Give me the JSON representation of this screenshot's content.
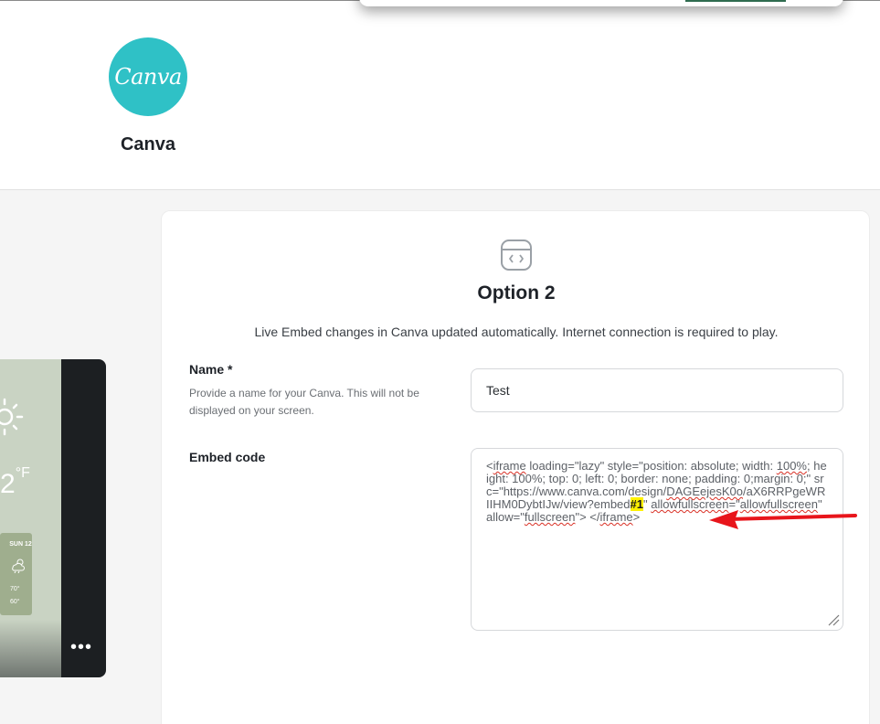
{
  "brand": {
    "logo_text": "Canva",
    "name": "Canva",
    "logo_color": "#2fc1c6"
  },
  "preview": {
    "temperature_suffix": "°F",
    "temperature_digit": "2",
    "forecast": {
      "day": "SUN 12",
      "high": "70°",
      "low": "60°"
    },
    "more_label": "•••"
  },
  "option": {
    "icon": "embed-code-icon",
    "title": "Option 2",
    "description": "Live Embed changes in Canva updated automatically. Internet connection is required to play."
  },
  "form": {
    "name_label": "Name *",
    "name_help": "Provide a name for your Canva. This will not be displayed on your screen.",
    "name_value": "Test",
    "embed_label": "Embed code",
    "embed_code": {
      "part1": "<",
      "part2": "iframe",
      "part3": " loading=\"lazy\" style=\"position: absolute; width: ",
      "part4": "100%",
      "part5": "; height: 100%; top: 0; left: 0; border: none; padding: 0;margin: 0;\" src=\"https://www.canva.com/design/",
      "part6": "DAGEejesK0o",
      "part7": "/",
      "part8": "aX6RRPgeWRIIHM0DybtIJw",
      "part9": "/view?embed",
      "part10": "#1",
      "part11": "\" ",
      "part12": "allowfullscreen",
      "part13": "=\"",
      "part14": "allowfullscreen",
      "part15": "\" allow=\"",
      "part16": "fullscreen",
      "part17": "\">   </",
      "part18": "iframe",
      "part19": ">"
    }
  },
  "colors": {
    "annotation_arrow": "#e8151b",
    "highlight": "#fff200"
  }
}
